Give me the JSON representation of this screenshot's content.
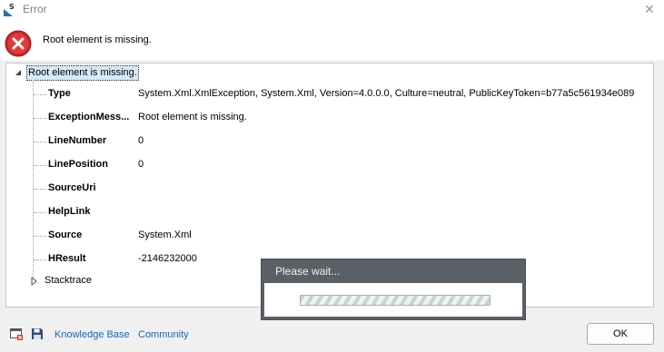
{
  "window": {
    "title": "Error",
    "app_icon": "s-app-icon",
    "close_icon": "close-icon"
  },
  "header": {
    "icon": "error-icon",
    "message": "Root element is missing."
  },
  "tree": {
    "root_label": "Root element is missing.",
    "properties": [
      {
        "key": "Type",
        "value": "System.Xml.XmlException, System.Xml, Version=4.0.0.0, Culture=neutral, PublicKeyToken=b77a5c561934e089"
      },
      {
        "key": "ExceptionMess...",
        "value": "Root element is missing."
      },
      {
        "key": "LineNumber",
        "value": "0"
      },
      {
        "key": "LinePosition",
        "value": "0"
      },
      {
        "key": "SourceUri",
        "value": ""
      },
      {
        "key": "HelpLink",
        "value": ""
      },
      {
        "key": "Source",
        "value": "System.Xml"
      },
      {
        "key": "HResult",
        "value": "-2146232000"
      }
    ],
    "stacktrace_label": "Stacktrace"
  },
  "footer": {
    "icons": [
      "window-error-icon",
      "save-icon"
    ],
    "knowledge_base_label": "Knowledge Base",
    "community_label": "Community",
    "ok_label": "OK"
  },
  "wait_dialog": {
    "title": "Please wait...",
    "progress": 1.0
  },
  "colors": {
    "link": "#1565c0",
    "error_red": "#d32f2f",
    "selection": "#d5e9f9",
    "wait_header": "#5a6068"
  }
}
